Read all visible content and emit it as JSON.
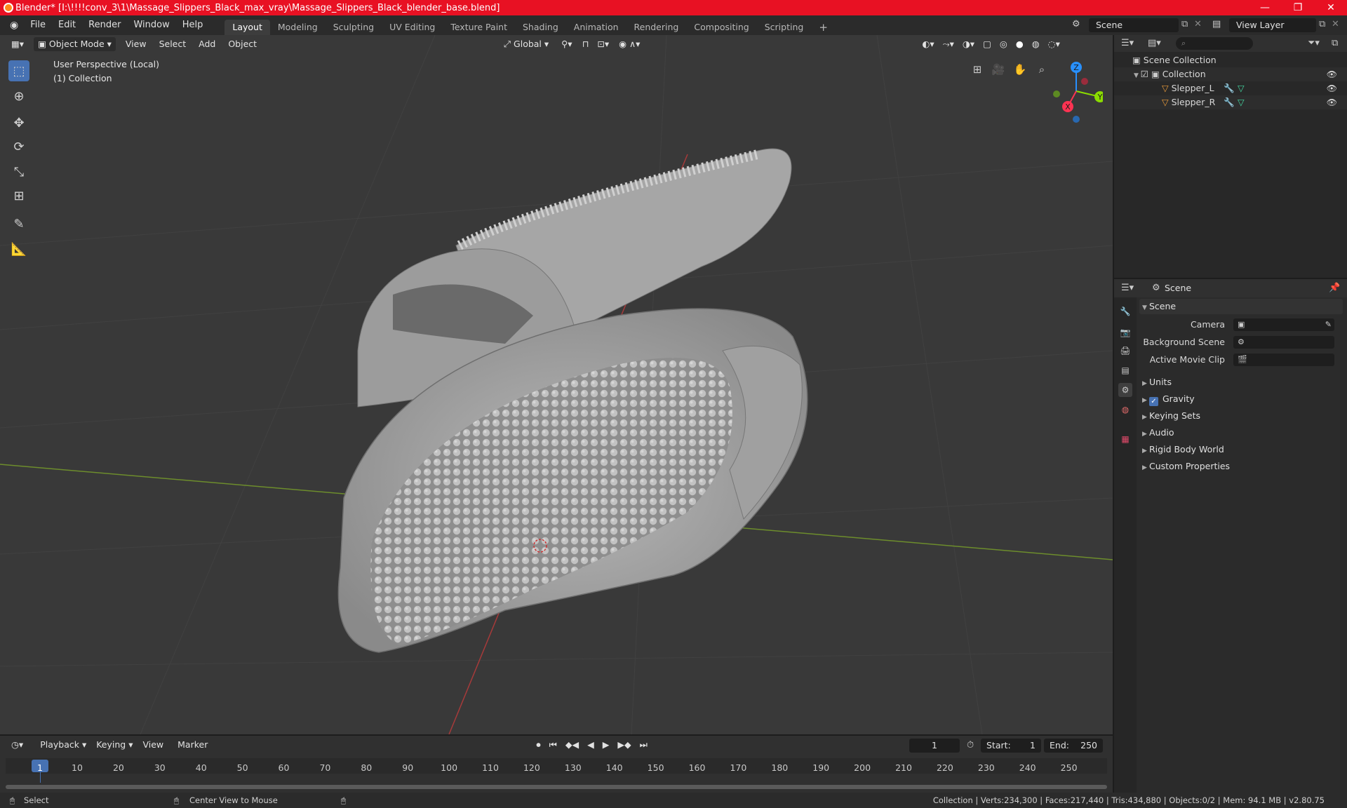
{
  "window": {
    "title": "Blender* [I:\\!!!!conv_3\\1\\Massage_Slippers_Black_max_vray\\Massage_Slippers_Black_blender_base.blend]",
    "minimize": "—",
    "maximize": "❐",
    "close": "✕"
  },
  "menubar": {
    "items": [
      "File",
      "Edit",
      "Render",
      "Window",
      "Help"
    ],
    "workspaces": [
      "Layout",
      "Modeling",
      "Sculpting",
      "UV Editing",
      "Texture Paint",
      "Shading",
      "Animation",
      "Rendering",
      "Compositing",
      "Scripting"
    ],
    "add_tab": "+",
    "scene_name": "Scene",
    "view_layer": "View Layer"
  },
  "viewport": {
    "mode": "Object Mode",
    "menus": [
      "View",
      "Select",
      "Add",
      "Object"
    ],
    "orientation": "Global",
    "overlay_line1": "User Perspective (Local)",
    "overlay_line2": "(1) Collection",
    "gizmo": {
      "z": "Z",
      "y": "Y",
      "x": "X"
    }
  },
  "outliner": {
    "root": "Scene Collection",
    "collection": "Collection",
    "objects": [
      "Slepper_L",
      "Slepper_R"
    ]
  },
  "properties": {
    "context": "Scene",
    "panel_title": "Scene",
    "fields": [
      {
        "label": "Camera",
        "value": ""
      },
      {
        "label": "Background Scene",
        "value": ""
      },
      {
        "label": "Active Movie Clip",
        "value": ""
      }
    ],
    "sections": [
      "Units",
      "Gravity",
      "Keying Sets",
      "Audio",
      "Rigid Body World",
      "Custom Properties"
    ]
  },
  "timeline": {
    "menus": [
      "Playback",
      "Keying",
      "View",
      "Marker"
    ],
    "current_frame": "1",
    "start_label": "Start:",
    "start": "1",
    "end_label": "End:",
    "end": "250",
    "ticks": [
      "1",
      "10",
      "20",
      "30",
      "40",
      "50",
      "60",
      "70",
      "80",
      "90",
      "100",
      "110",
      "120",
      "130",
      "140",
      "150",
      "160",
      "170",
      "180",
      "190",
      "200",
      "210",
      "220",
      "230",
      "240",
      "250"
    ]
  },
  "statusbar": {
    "left": "Select",
    "middle": "Center View to Mouse",
    "right": "Collection | Verts:234,300 | Faces:217,440 | Tris:434,880 | Objects:0/2 | Mem: 94.1 MB | v2.80.75"
  },
  "colors": {
    "titlebar": "#e81123",
    "accent": "#4772b3",
    "x_axis": "#ff3352",
    "y_axis": "#8bdc00",
    "z_axis": "#2890ff"
  }
}
